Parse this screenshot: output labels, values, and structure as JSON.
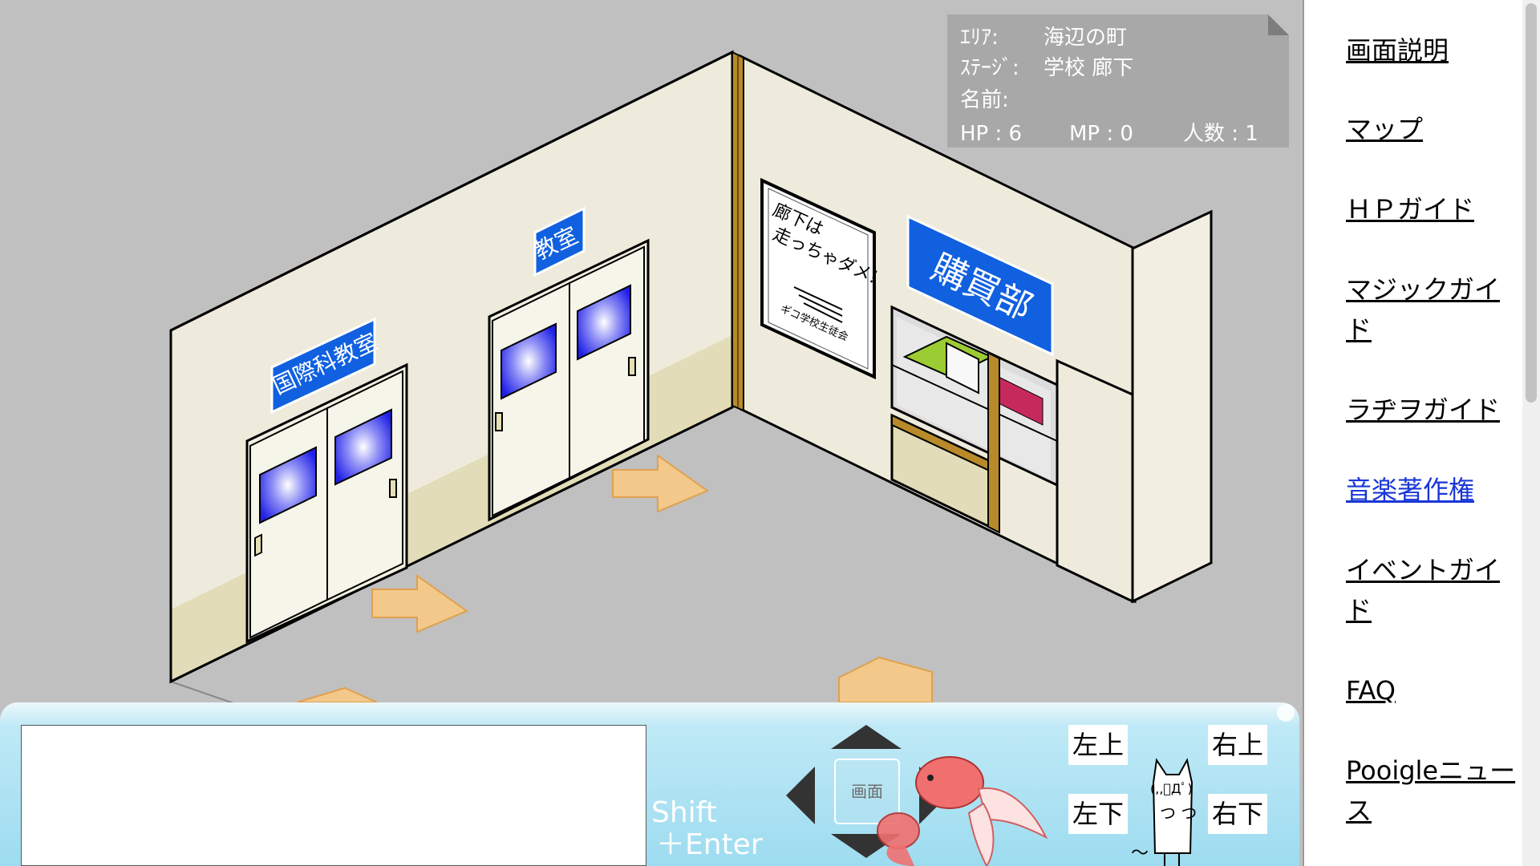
{
  "status": {
    "area_label": "ｴﾘｱ:",
    "area_value": "海辺の町",
    "stage_label": "ｽﾃｰｼﾞ:",
    "stage_value": "学校 廊下",
    "name_label": "名前:",
    "name_value": "",
    "hp": "HP : 6",
    "mp": "MP : 0",
    "people": "人数 : 1"
  },
  "scene": {
    "sign_intl": "国際科教室",
    "sign_class": "教室",
    "sign_shop": "購買部",
    "poster_line1": "廊下は",
    "poster_line2": "走っちゃダメ!",
    "poster_footer": "ギコ学校生徒会"
  },
  "sidebar": {
    "items": [
      {
        "label": "画面説明"
      },
      {
        "label": "マップ"
      },
      {
        "label": "ＨＰガイド"
      },
      {
        "label": "マジックガイド"
      },
      {
        "label": "ラヂヲガイド"
      },
      {
        "label": "音楽著作権"
      },
      {
        "label": "イベントガイド"
      },
      {
        "label": "FAQ"
      },
      {
        "label": "Pooigleニュース"
      }
    ]
  },
  "controls": {
    "shift_line1": "Shift",
    "shift_line2": "＋Enter",
    "screen_label": "画面",
    "upper_left": "左上",
    "upper_right": "右上",
    "lower_left": "左下",
    "lower_right": "右下",
    "mascot_face": "(,,ﾟДﾟ)",
    "mascot_hands": "つ つ",
    "mascot_tilde": "～"
  },
  "colors": {
    "floor": "#c0c0c0",
    "wall": "#eeebdc",
    "wainscot": "#e2dcb8",
    "sign_blue": "#1060e0",
    "floor_arrow": "#f2c98a",
    "panel_blue": "#9ddcf0",
    "link_visited": "#1a37d6"
  }
}
